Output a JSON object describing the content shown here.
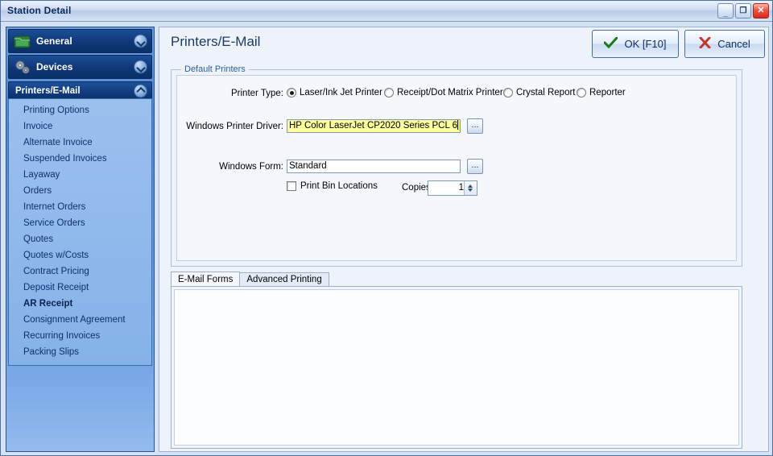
{
  "window": {
    "title": "Station Detail",
    "buttons": {
      "minimize": "minimize-button",
      "maximize": "maximize-button",
      "close": "close-button"
    }
  },
  "sidebar": {
    "sections": [
      {
        "label": "General",
        "icon": "folder-icon",
        "state": "collapsed",
        "chevron": "chevron-down-icon"
      },
      {
        "label": "Devices",
        "icon": "devices-icon",
        "state": "collapsed",
        "chevron": "chevron-down-icon"
      },
      {
        "label": "Printers/E-Mail",
        "icon": "",
        "state": "expanded",
        "chevron": "chevron-up-icon"
      }
    ],
    "items": [
      {
        "label": "Printing Options",
        "selected": false
      },
      {
        "label": "Invoice",
        "selected": false
      },
      {
        "label": "Alternate Invoice",
        "selected": false
      },
      {
        "label": "Suspended Invoices",
        "selected": false
      },
      {
        "label": "Layaway",
        "selected": false
      },
      {
        "label": "Orders",
        "selected": false
      },
      {
        "label": "Internet Orders",
        "selected": false
      },
      {
        "label": "Service Orders",
        "selected": false
      },
      {
        "label": "Quotes",
        "selected": false
      },
      {
        "label": "Quotes w/Costs",
        "selected": false
      },
      {
        "label": "Contract Pricing",
        "selected": false
      },
      {
        "label": "Deposit Receipt",
        "selected": false
      },
      {
        "label": "AR Receipt",
        "selected": true
      },
      {
        "label": "Consignment Agreement",
        "selected": false
      },
      {
        "label": "Recurring Invoices",
        "selected": false
      },
      {
        "label": "Packing Slips",
        "selected": false
      }
    ]
  },
  "main": {
    "page_title": "Printers/E-Mail",
    "ok_label": "OK [F10]",
    "ok_icon": "check-icon",
    "cancel_label": "Cancel",
    "cancel_icon": "x-icon",
    "default_printers": {
      "group_title": "Default Printers",
      "printer_type_label": "Printer Type:",
      "printer_type_options": [
        {
          "label": "Laser/Ink Jet Printer",
          "selected": true
        },
        {
          "label": "Receipt/Dot Matrix Printer",
          "selected": false
        },
        {
          "label": "Crystal Report",
          "selected": false
        },
        {
          "label": "Reporter",
          "selected": false
        }
      ],
      "driver_label": "Windows Printer Driver:",
      "driver_value": "HP Color LaserJet CP2020 Series PCL 6",
      "driver_browse_label": "...",
      "form_label": "Windows Form:",
      "form_value": "Standard",
      "form_browse_label": "...",
      "print_bin_label": "Print Bin Locations",
      "print_bin_checked": false,
      "copies_label": "Copies:",
      "copies_value": "1"
    },
    "tabs": [
      {
        "label": "E-Mail Forms",
        "active": true
      },
      {
        "label": "Advanced Printing",
        "active": false
      }
    ]
  },
  "colors": {
    "title_text": "#0a2a5e",
    "nav_header": "#10397a",
    "nav_list_bg": "#8fb8ec",
    "accent": "#2a5fa5",
    "highlight_field": "#ffff9c",
    "selection": "#ffff00",
    "ok_check": "#1a7a1a",
    "cancel_x": "#c0392b"
  }
}
